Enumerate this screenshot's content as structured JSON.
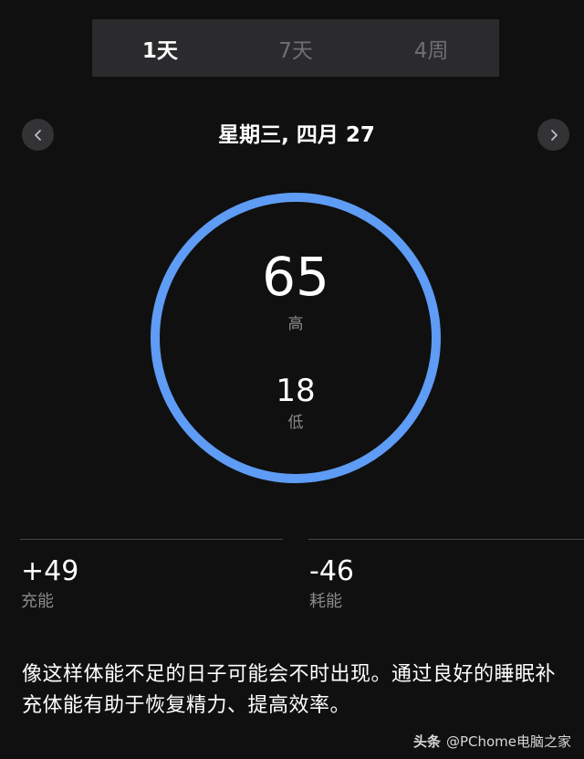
{
  "tabs": [
    {
      "label": "1天",
      "active": true
    },
    {
      "label": "7天",
      "active": false
    },
    {
      "label": "4周",
      "active": false
    }
  ],
  "date_nav": {
    "title": "星期三, 四月 27",
    "prev_icon": "chevron-left-icon",
    "next_icon": "chevron-right-icon"
  },
  "ring": {
    "color": "#5e9cf5",
    "high_value": "65",
    "high_label": "高",
    "low_value": "18",
    "low_label": "低"
  },
  "stats": {
    "charge": {
      "value": "+49",
      "label": "充能"
    },
    "drain": {
      "value": "-46",
      "label": "耗能"
    }
  },
  "description": "像这样体能不足的日子可能会不时出现。通过良好的睡眠补充体能有助于恢复精力、提高效率。",
  "watermark": {
    "brand": "头条",
    "handle": "@PChome电脑之家"
  }
}
